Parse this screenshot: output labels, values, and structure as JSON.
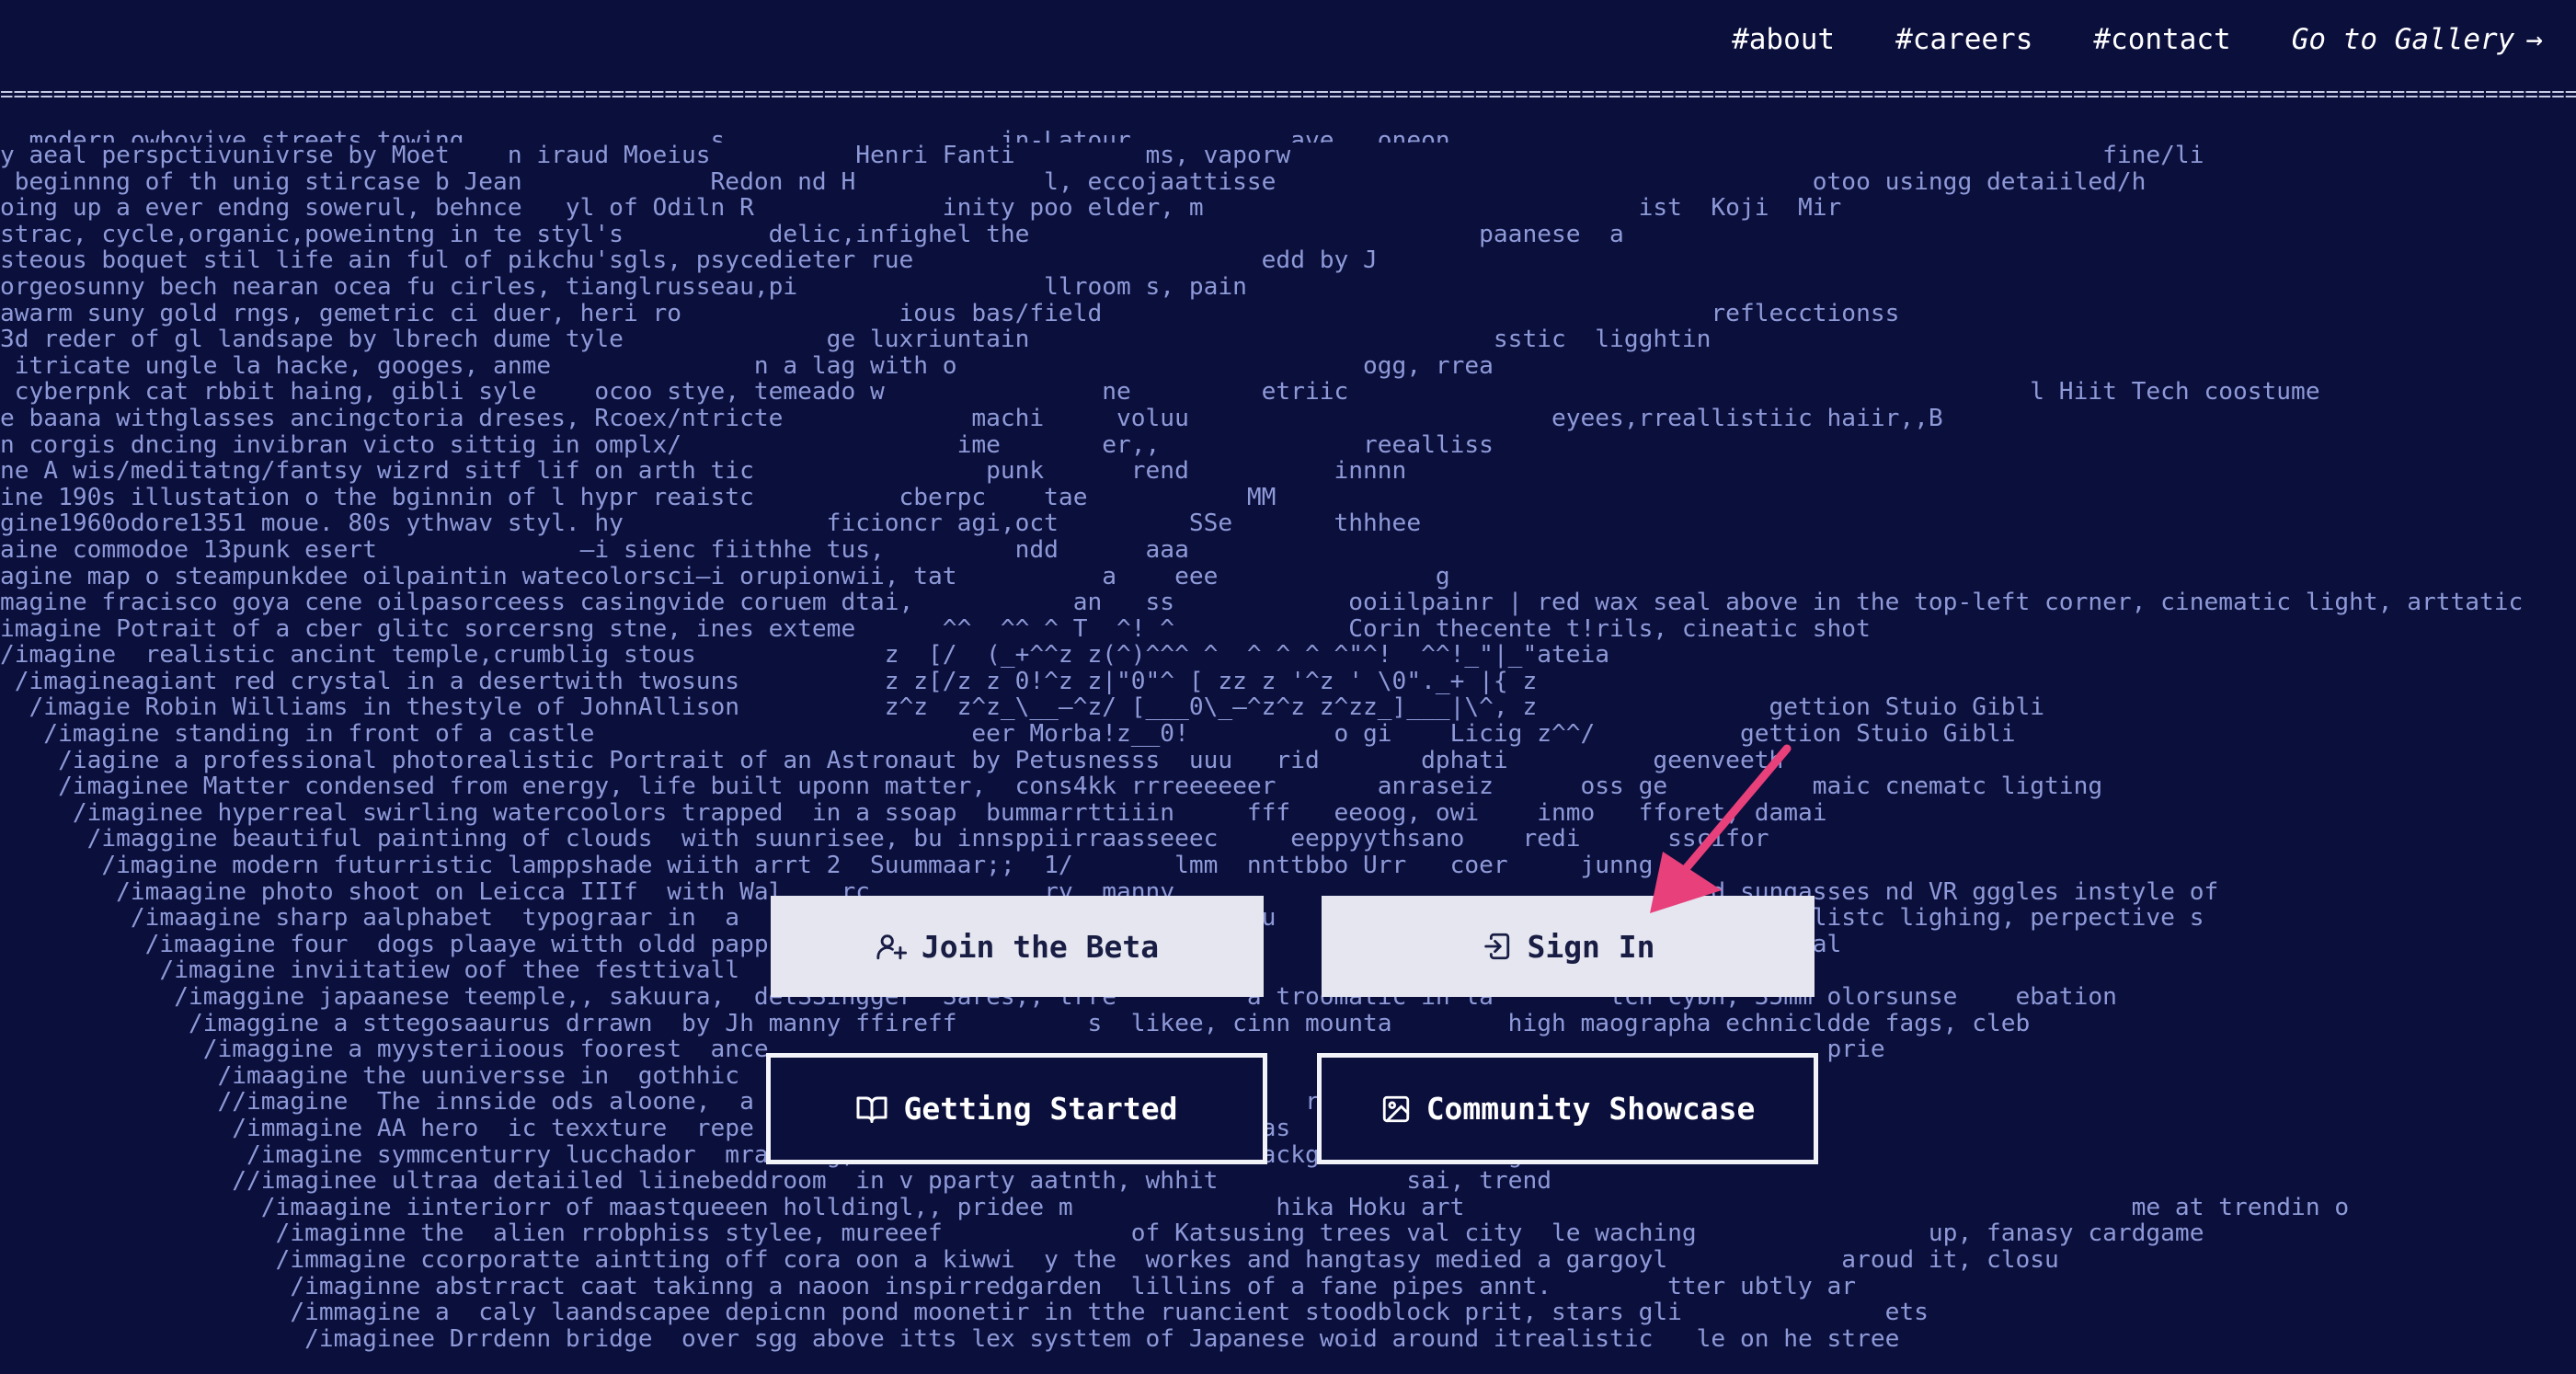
{
  "nav": {
    "about": "#about",
    "careers": "#careers",
    "contact": "#contact",
    "gallery": "Go to Gallery",
    "gallery_arrow": "→"
  },
  "divider_text": "========================================================================================================================================================================================================",
  "background_lines": [
    ", modern owboyive.streets towing,                s                   in-Latour           ave,  oneon",
    "y aeal perspctivunivrse by Moet    n iraud Moeius          Henri Fanti         ms, vaporw                                                        fine/li",
    " beginnng of th unig stircase b Jean             Redon nd H             l, eccojaattisse                                     otoo usingg detaiiled/h",
    "oing up a ever endng sowerul, behnce   yl of Odiln R             inity poo elder, m                              ist  Koji  Mir",
    "strac, cycle,organic,poweintng in te styl's          delic,infighel the                               paanese  a",
    "steous boquet stil life ain ful of pikchu'sgls, psycedieter rue                        edd by J",
    "orgeosunny bech nearan ocea fu cirles, tianglrusseau,pi                 llroom s, pain",
    "awarm suny gold rngs, gemetric ci duer, heri ro               ious bas/field                                          reflecctionss",
    "3d reder of gl landsape by lbrech dume tyle              ge luxriuntain                                sstic  ligghtin",
    " itricate ungle la hacke, googes, anme              n a lag with o                            ogg, rrea",
    " cyberpnk cat rbbit haing, gibli syle    ocoo stye, temeado w               ne         etriic                                               l Hiit Tech coostume",
    "e baana withglasses ancingctoria dreses, Rcoex/ntricte             machi     voluu                         eyees,rreallistiic haiir,,B",
    "n corgis dncing invibran victo sittig in omplx/                   ime       er,,              reealliss",
    "ne A wis/meditatng/fantsy wizrd sitf lif on arth tic                punk      rend          innnn",
    "ine 190s illustation o the bginnin of l hypr reaistc          cberpc    tae           MM",
    "gine1960odore1351 moue. 80s ythwav styl. hy              ficioncr agi,oct         SSe       thhhee",
    "aine commodoe 13punk esert              —i sienc fiithhe tus,         ndd      aaa",
    "agine map o steampunkdee oilpaintin watecolorsci—i orupionwii, tat          a    eee               g",
    "magine fracisco goya cene oilpasorceess casingvide coruem dtai,           an   ss            ooiilpainr | red wax seal above in the top-left corner, cinematic light, arttatic",
    "imagine Potrait of a cber glitc sorcersng stne, ines exteme      ^^  ^^ ^ T  ^! ^            Corin thecente t!rils, cineatic shot",
    "/imagine  realistic ancint temple,crumblig stous             z  [/  (_+^^z z(^)^^^ ^  ^ ^ ^ ^\"^!  ^^!_\"|_\"ateia",
    " /imagineagiant red crystal in a desertwith twosuns          z z[/z z 0!^z z|\"0\"^ [ zz z '^z ' \\0\"._+ |{ z",
    "  /imagie Robin Williams in thestyle of JohnAllison          z^z  z^z_\\__–^z/ [___0\\_–^z^z z^zz_]___|\\^, z                gettion Stuio Gibli",
    "   /imagine standing in front of a castle                          eer Morba!z__0!          o gi    Licig z^^/          gettion Stuio Gibli",
    "    /iagine a professional photorealistic Portrait of an Astronaut by Petusnesss  uuu   rid       dphati          geenveeth",
    "    /imaginee Matter condensed from energy, life built uponn matter,  cons4kk rrreeeeeer       anraseiz      oss ge          maic cnematc ligting",
    "     /imaginee hyperreal swirling watercoolors trapped  in a ssoap  bummarrttiiin     fff   eeoog, owi    inmo   fforet, damai",
    "      /imaggine beautiful paintinng of clouds  with suunrisee, bu innsppiirraasseeec     eeppyythsano    redi      sscifor",
    "       /imagine modern futurristic lamppshade wiith arrt 2  Suummaar;;  1/       lmm  nnttbbo Urr   coer     junng",
    "        /imaagine photo shoot on Leicca IIIf  with Wal    rc            ry  manny                                     d sungasses nd VR gggles instyle of",
    "         /imaagine sharp aalphabet  typograar in  a  ci          ecrt   oMat        lllu                  thheadhonesand suealistc lighing, perpective s",
    "          /imaagine four  dogs plaaye witth oldd papp       tuunn      llaa         hhi            lesha wth ne pitc blac, real",
    "           /imagine inviitatiew oof thee festtivall    hhe     bbee   aarrdd                         iin   e moie scne,",
    "            /imaggine japaanese teemple,, sakuura,  detSSingger  Sares,, trre         a troomatic in la        tch cybh, 35mm olorsunse    ebation",
    "             /imaggine a sttegosaaurus drrawn  by Jh manny ffireff         s  likee, cinn mounta        high maographa echnicldde fags, cleb",
    "              /imaggine a myysteriioous foorest  ance                                                                         prie",
    "               /imaagine the uuniversse in  gothhic",
    "               //imagine  The innside ods aloone,  a                                      rees",
    "                /immagine AA hero  ic texxture  repe                                 wias                       sttion",
    "                 /imagine symmcenturry lucchador  mrawiing, bbtactoorian  mane domme  backgro        dingon art",
    "                //imaginee ultraa detaiiled liinebeddroom  in v pparty aatnth, whhit             sai, trend",
    "                  /imaagine iinteriorr of maastqueeen holldingl,, pridee m              hika Hoku art                                              me at trendin o",
    "                   /imaginne the  alien rrobphiss stylee, mureeef             of Katsusing trees val city  le waching                up, fanasy cardgame",
    "                   /immagine ccorporatte aintting off cora oon a kiwwi  y the  workes and hangtasy medied a gargoyl            aroud it, closu",
    "                    /imaginne abstrract caat takinng a naoon inspirredgarden  lillins of a fane pipes annt.        tter ubtly ar",
    "                    /immagine a  caly laandscapee depicnn pond moonetir in tthe ruancient stoodblock prit, stars gli              ets",
    "                     /imaginee Drrdenn bridge  over sgg above itts lex systtem of Japanese woid around itrealistic   le on he stree"
  ],
  "buttons": {
    "join_beta": "Join the Beta",
    "sign_in": "Sign In",
    "getting_started": "Getting Started",
    "community_showcase": "Community Showcase"
  },
  "colors": {
    "background": "#0b0f3c",
    "text": "#8e9ad8",
    "light_button": "#e5e6f0",
    "arrow": "#e8407a"
  },
  "icons": {
    "join_beta": "user-plus-icon",
    "sign_in": "sign-in-icon",
    "getting_started": "book-icon",
    "community_showcase": "image-icon",
    "gallery": "arrow-right-icon"
  }
}
